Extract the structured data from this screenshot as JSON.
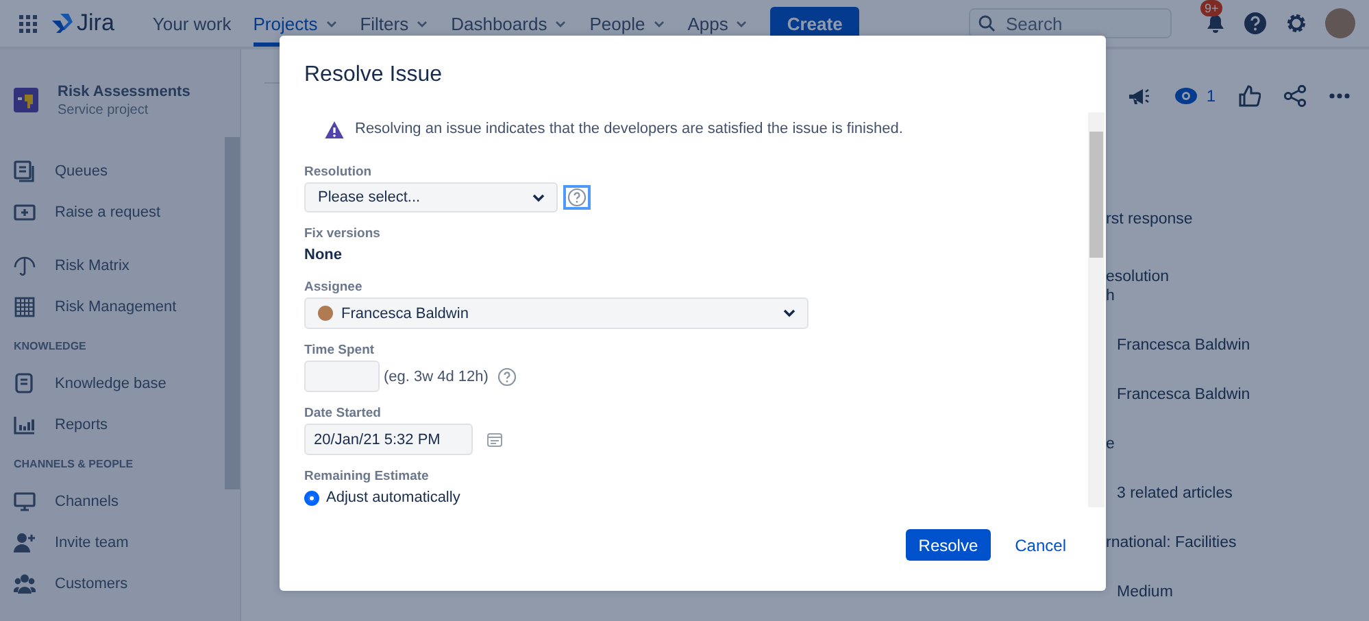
{
  "topbar": {
    "app_name": "Jira",
    "nav": [
      {
        "label": "Your work",
        "selected": false,
        "dropdown": false
      },
      {
        "label": "Projects",
        "selected": true,
        "dropdown": true
      },
      {
        "label": "Filters",
        "selected": false,
        "dropdown": true
      },
      {
        "label": "Dashboards",
        "selected": false,
        "dropdown": true
      },
      {
        "label": "People",
        "selected": false,
        "dropdown": true
      },
      {
        "label": "Apps",
        "selected": false,
        "dropdown": true
      }
    ],
    "create_button": "Create",
    "search": {
      "placeholder": "Search"
    },
    "notifications_badge": "9+"
  },
  "sidebar": {
    "project": {
      "name": "Risk Assessments",
      "type": "Service project"
    },
    "groups": [
      {
        "items": [
          {
            "label": "Queues",
            "selected": false
          },
          {
            "label": "Raise a request",
            "selected": false
          }
        ]
      },
      {
        "items": [
          {
            "label": "Risk Matrix",
            "selected": false
          },
          {
            "label": "Risk Management",
            "selected": false
          }
        ]
      },
      {
        "heading": "KNOWLEDGE",
        "items": [
          {
            "label": "Knowledge base",
            "selected": false
          },
          {
            "label": "Reports",
            "selected": false
          }
        ]
      },
      {
        "heading": "CHANNELS & PEOPLE",
        "items": [
          {
            "label": "Channels",
            "selected": false
          },
          {
            "label": "Invite team",
            "selected": false
          },
          {
            "label": "Customers",
            "selected": false
          }
        ]
      }
    ]
  },
  "issue_panel": {
    "watchers": "1",
    "fields": [
      {
        "kind": "heading",
        "text": "rst response"
      },
      {
        "kind": "heading",
        "text": "esolution",
        "sub": "h"
      },
      {
        "kind": "value",
        "text": "Francesca Baldwin"
      },
      {
        "kind": "value",
        "text": "Francesca Baldwin"
      },
      {
        "kind": "heading",
        "text": "e"
      },
      {
        "kind": "value",
        "text": "3 related articles"
      },
      {
        "kind": "heading",
        "text": "rnational: Facilities"
      },
      {
        "kind": "value",
        "text": "Medium"
      }
    ]
  },
  "dialog": {
    "title": "Resolve Issue",
    "warning": "Resolving an issue indicates that the developers are satisfied the issue is finished.",
    "fields": [
      {
        "kind": "select",
        "label": "Resolution",
        "value": "Please select...",
        "help": true,
        "focused": true
      },
      {
        "kind": "static",
        "label": "Fix versions",
        "value": "None"
      },
      {
        "kind": "user_select",
        "label": "Assignee",
        "value": "Francesca Baldwin"
      },
      {
        "kind": "duration",
        "label": "Time Spent",
        "hint": "(eg. 3w 4d 12h)",
        "help": true,
        "focused": false
      },
      {
        "kind": "date",
        "label": "Date Started",
        "value": "20/Jan/21 5:32 PM"
      },
      {
        "kind": "radio",
        "label": "Remaining Estimate",
        "options": [
          {
            "label": "Adjust automatically",
            "selected": true
          }
        ]
      }
    ],
    "primary_button": "Resolve",
    "cancel_link": "Cancel"
  }
}
